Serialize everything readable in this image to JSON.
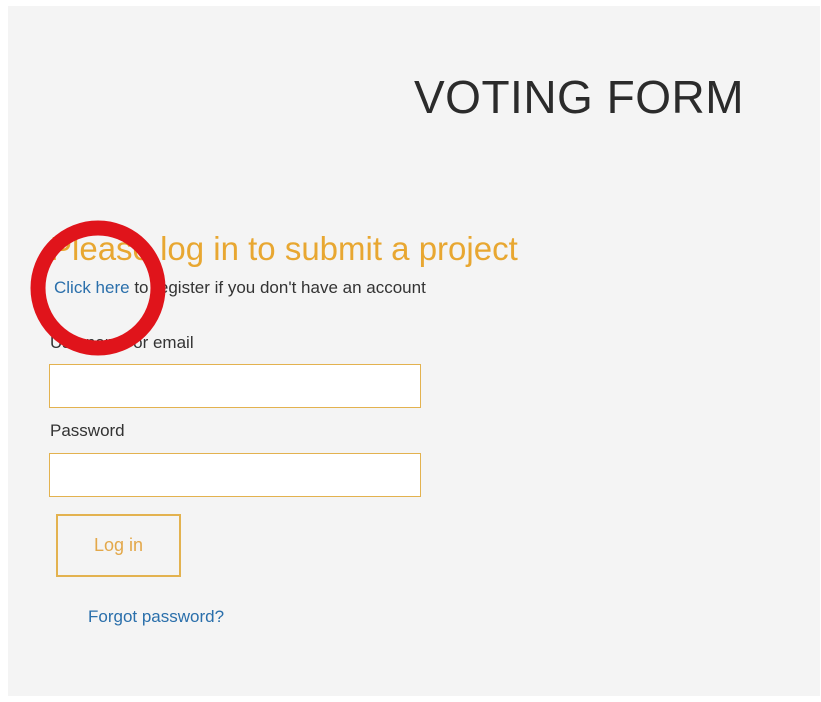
{
  "page": {
    "title": "VOTING FORM"
  },
  "login": {
    "heading": "Please log in to submit a project",
    "register_link": "Click here",
    "register_text": " to register if you don't have an account",
    "username_label": "Username or email",
    "username_value": "",
    "password_label": "Password",
    "password_value": "",
    "login_button": "Log in",
    "forgot_link": "Forgot password?"
  },
  "annotation": {
    "icon": "red-circle-highlight-icon",
    "color": "#e0141b"
  },
  "colors": {
    "accent": "#e8a731",
    "link": "#2a6fab",
    "panel_background": "#f4f4f4"
  }
}
